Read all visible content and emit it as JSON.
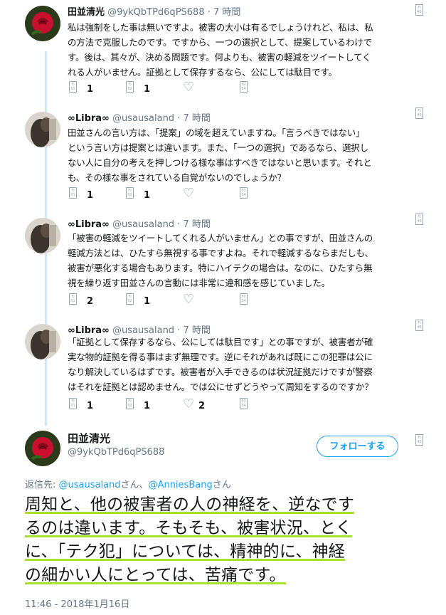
{
  "thread": [
    {
      "name": "田並清光",
      "handle": "@9ykQbTPd6qPS688",
      "time": "7 時間",
      "avatar": "red-rose",
      "lines": [
        "私は強制をした事は無いですよ。被害の大小は有るでしょうけれど、私は、私",
        "の方法で克服したのです。ですから、一つの選択として、提案しているわけで",
        "す。後は、其々が、決める問題です。何よりも、被害の軽減をツイートしてく",
        "れる人がいません。証拠として保存するなら、公にしては駄目です。"
      ],
      "reply_count": "1",
      "retweet_count": "1",
      "like_count": ""
    },
    {
      "name": "∞Libra∞",
      "handle": "@usausaland",
      "time": "7 時間",
      "avatar": "dark-figure",
      "lines": [
        "田並さんの言い方は、「提案」の域を超えていますね。「言うべきではない」",
        "という言い方は提案とは違います。また、「一つの選択」であるなら、選択し",
        "ない人に自分の考えを押しつける様な事はすべきではないと思います。それと",
        "も、その様な事をされている自覚がないのでしょうか？"
      ],
      "reply_count": "1",
      "retweet_count": "1",
      "like_count": ""
    },
    {
      "name": "∞Libra∞",
      "handle": "@usausaland",
      "time": "7 時間",
      "avatar": "dark-figure",
      "lines": [
        "「被害の軽減をツイートしてくれる人がいません」との事ですが、田並さんの",
        "軽減方法とは、ひたすら無視する事ですよね。それで軽減するならまだしも、",
        "被害が悪化する場合もあります。特にハイテクの場合は。なのに、ひたすら無",
        "視を繰り返す田並さんの言動には非常に違和感を感じていました。"
      ],
      "reply_count": "2",
      "retweet_count": "1",
      "like_count": ""
    },
    {
      "name": "∞Libra∞",
      "handle": "@usausaland",
      "time": "7 時間",
      "avatar": "dark-figure",
      "lines": [
        "「証拠として保存するなら、公にしては駄目です」との事ですが、被害者が確",
        "実な物的証拠を得る事はまず無理です。逆にそれがあれば既にこの犯罪は公に",
        "なり解決しているはずです。被害者が入手できるのは状況証拠だけですが警察",
        "はそれを証拠とは認めません。では公にせずどうやって周知をするのですか？"
      ],
      "reply_count": "1",
      "retweet_count": "1",
      "like_count": "2"
    }
  ],
  "main": {
    "name": "田並清光",
    "handle": "@9ykQbTPd6qPS688",
    "follow_label": "フォローする",
    "reply_prefix": "返信先: ",
    "reply_user1": "@usausaland",
    "reply_mid": "さん、",
    "reply_user2": "@AnniesBang",
    "reply_suffix": "さん",
    "lines": [
      "周知と、他の被害者の人の神経を、逆なです",
      "るのは違います。そもそも、被害状況、とく",
      "に、「テク犯」については、精神的に、神経",
      "の細かい人にとっては、苦痛です。"
    ],
    "timestamp": "11:46 - 2018年1月16日"
  },
  "icons": {
    "reply": "reply-icon",
    "retweet": "retweet-icon",
    "like": "heart-icon",
    "dm": "message-icon",
    "caret": "caret-icon"
  },
  "colors": {
    "accent": "#1da1f2",
    "thread_line": "#cde6ff",
    "highlight": "#a6e22e"
  }
}
